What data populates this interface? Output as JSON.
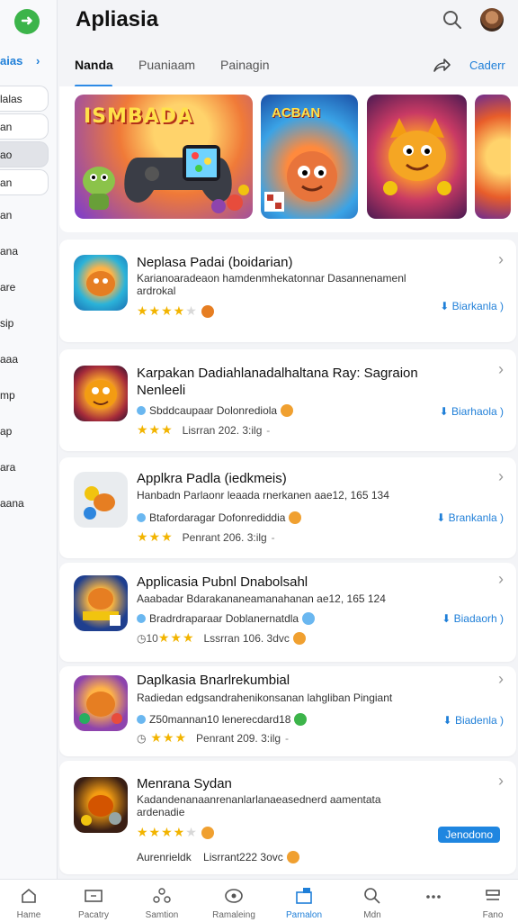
{
  "app": {
    "title": "Apliasia"
  },
  "sidebar": {
    "heading": "aias",
    "items": [
      "lalas",
      "an",
      "ao",
      "an",
      "an",
      "ana",
      "are",
      "sip",
      "aaa",
      "mp",
      "ap",
      "ara",
      "aana"
    ]
  },
  "tabs": [
    {
      "label": "Nanda",
      "active": true
    },
    {
      "label": "Puaniaam",
      "active": false
    },
    {
      "label": "Painagin",
      "active": false
    }
  ],
  "tabs_link": "Caderr",
  "banners": [
    {
      "text": "ISMBADA"
    },
    {
      "text": "ACBAN"
    },
    {
      "text": ""
    },
    {
      "text": ""
    }
  ],
  "apps": [
    {
      "name": "Neplasa Padai (boidarian)",
      "desc": "Karianoaradeaon hamdenmhekatonnar Dasannenamenl ardrokal",
      "meta": "",
      "stars": 4,
      "prefix": "",
      "rating": "",
      "install": "Biarkanla )",
      "button": false
    },
    {
      "name": "Karpakan Dadiahlanadalhaltana Ray: Sagraion Nenleeli",
      "desc": "",
      "meta": "Sbddcaupaar Dolonrediola",
      "stars": 3,
      "prefix": "",
      "rating": "Lisrran 202. 3:ilg",
      "install": "Biarhaola )",
      "button": false
    },
    {
      "name": "Applkra Padla (iedkmeis)",
      "desc": "Hanbadn Parlaonr leaada rnerkanen aae12, 165 134",
      "meta": "Btafordaragar Dofonrediddia",
      "stars": 3,
      "prefix": "",
      "rating": "Penrant 206. 3:ilg",
      "install": "Brankanla )",
      "button": false
    },
    {
      "name": "Applicasia Pubnl Dnabolsahl",
      "desc": "Aaabadar Bdarakananeamanahanan ae12, 165 124",
      "meta": "Bradrdraparaar Doblanernatdla",
      "stars": 3,
      "prefix": "10",
      "rating": "Lssrran 106. 3dvc",
      "install": "Biadaorh )",
      "button": false
    },
    {
      "name": "Daplkasia Bnarlrekumbial",
      "desc": "Radiedan edgsandrahenikonsanan lahgliban Pingiant",
      "meta": "Z50mannan10 lenerecdard18",
      "stars": 3,
      "prefix": "",
      "rating": "Penrant 209. 3:ilg",
      "install": "Biadenla )",
      "button": false
    },
    {
      "name": "Menrana Sydan",
      "desc": "Kadandenanaanrenanlarlanaeasednerd aamentata ardenadie",
      "meta": "",
      "stars": 4,
      "prefix": "",
      "rating": "",
      "install": "Jenodono",
      "button": true,
      "footer_left": "Aurenrieldk",
      "footer_right": "Lisrrant222 3ovc"
    }
  ],
  "nav": [
    {
      "label": "Hame",
      "icon": "home-icon",
      "active": false
    },
    {
      "label": "Pacatry",
      "icon": "category-icon",
      "active": false
    },
    {
      "label": "Samtion",
      "icon": "apps-icon",
      "active": false
    },
    {
      "label": "Ramaleing",
      "icon": "chat-icon",
      "active": false
    },
    {
      "label": "Parnalon",
      "icon": "download-icon",
      "active": true
    },
    {
      "label": "Mdn",
      "icon": "search-icon",
      "active": false
    },
    {
      "label": "",
      "icon": "more-icon",
      "active": false
    },
    {
      "label": "Fano",
      "icon": "menu-icon",
      "active": false
    }
  ],
  "colors": {
    "accent": "#1f7fd8",
    "star": "#f2b400",
    "logo": "#3cb44a"
  }
}
